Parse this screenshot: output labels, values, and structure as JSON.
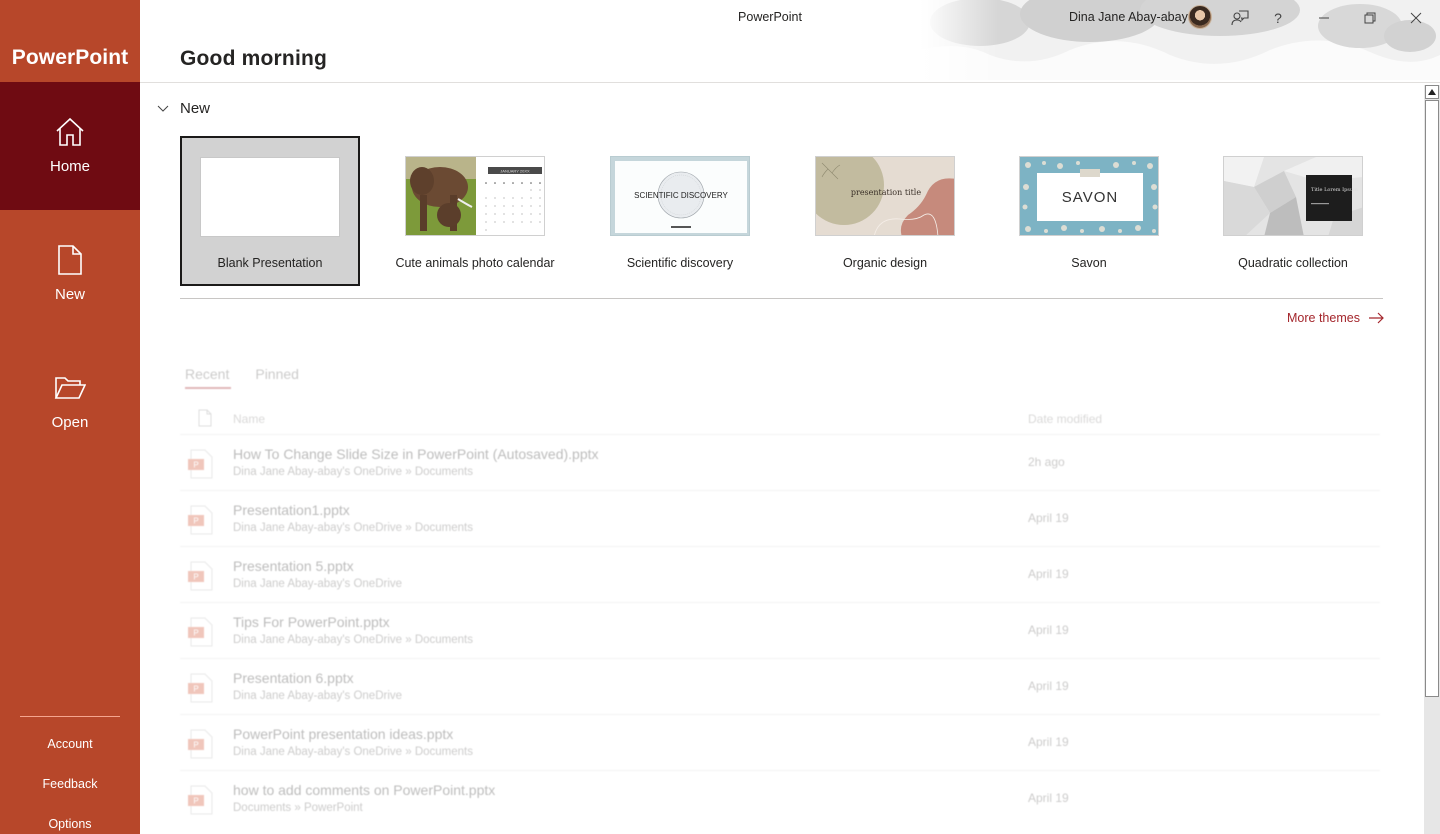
{
  "app": {
    "name": "PowerPoint",
    "window_title": "PowerPoint",
    "brand_color": "#b7472a",
    "active_nav_color": "#6f0b12",
    "link_color": "#a4262c"
  },
  "sidebar": {
    "nav": [
      {
        "label": "Home",
        "icon": "home-icon",
        "active": true
      },
      {
        "label": "New",
        "icon": "new-document-icon",
        "active": false
      },
      {
        "label": "Open",
        "icon": "open-folder-icon",
        "active": false
      }
    ],
    "footer": [
      {
        "label": "Account"
      },
      {
        "label": "Feedback"
      },
      {
        "label": "Options"
      }
    ]
  },
  "titlebar": {
    "user_name": "Dina Jane Abay-abay",
    "help_glyph": "?",
    "icons": [
      "avatar",
      "feedback-icon",
      "help-icon",
      "minimize-icon",
      "restore-icon",
      "close-icon"
    ]
  },
  "main": {
    "greeting": "Good morning",
    "new_section": {
      "label": "New",
      "expanded": true,
      "templates": [
        {
          "name": "Blank Presentation",
          "selected": true
        },
        {
          "name": "Cute animals photo calendar",
          "thumb_text": "JANUARY 20XX"
        },
        {
          "name": "Scientific discovery",
          "thumb_text": "SCIENTIFIC DISCOVERY"
        },
        {
          "name": "Organic design",
          "thumb_text": "presentation title"
        },
        {
          "name": "Savon",
          "thumb_text": "SAVON"
        },
        {
          "name": "Quadratic collection",
          "thumb_text": "Title Lorem Ipsum"
        }
      ],
      "more_themes": "More themes"
    },
    "recent": {
      "tabs": [
        {
          "label": "Recent",
          "active": true
        },
        {
          "label": "Pinned",
          "active": false
        }
      ],
      "columns": {
        "name": "Name",
        "date": "Date modified"
      },
      "files": [
        {
          "name": "How To Change Slide Size in PowerPoint (Autosaved).pptx",
          "path": "Dina Jane Abay-abay's OneDrive » Documents",
          "date": "2h ago"
        },
        {
          "name": "Presentation1.pptx",
          "path": "Dina Jane Abay-abay's OneDrive » Documents",
          "date": "April 19"
        },
        {
          "name": "Presentation 5.pptx",
          "path": "Dina Jane Abay-abay's OneDrive",
          "date": "April 19"
        },
        {
          "name": "Tips For PowerPoint.pptx",
          "path": "Dina Jane Abay-abay's OneDrive » Documents",
          "date": "April 19"
        },
        {
          "name": "Presentation 6.pptx",
          "path": "Dina Jane Abay-abay's OneDrive",
          "date": "April 19"
        },
        {
          "name": "PowerPoint presentation ideas.pptx",
          "path": "Dina Jane Abay-abay's OneDrive » Documents",
          "date": "April 19"
        },
        {
          "name": "how to add comments on PowerPoint.pptx",
          "path": "Documents » PowerPoint",
          "date": "April 19"
        }
      ]
    }
  }
}
